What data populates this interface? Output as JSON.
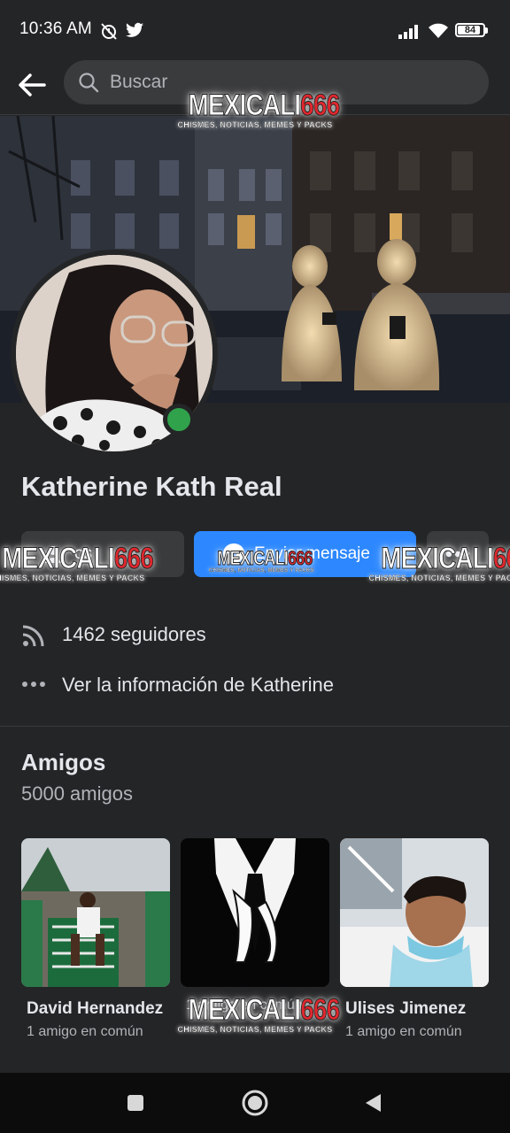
{
  "status_bar": {
    "time": "10:36 AM",
    "battery": "84",
    "icons": [
      "mute-alarm-icon",
      "twitter-icon",
      "signal-icon",
      "wifi-icon",
      "battery-icon"
    ]
  },
  "header": {
    "search_placeholder": "Buscar"
  },
  "profile": {
    "name": "Katherine Kath Real",
    "online": true
  },
  "actions": {
    "friends_label": "Amigos",
    "friends_visible": "os",
    "message_label": "Enviar mensaje",
    "message_visible": "Enviar mensaje"
  },
  "info": {
    "followers": "1462 seguidores",
    "see_info": "Ver la información de Katherine"
  },
  "friends": {
    "title": "Amigos",
    "count": "5000 amigos",
    "items": [
      {
        "name": "David Hernandez",
        "mutual": "1 amigo en común"
      },
      {
        "name": "",
        "mutual": "1 amigo en común"
      },
      {
        "name": "Ulises Jimenez",
        "mutual": "1 amigo en común"
      }
    ]
  },
  "watermark": {
    "text": "MEXICALI",
    "number": "666",
    "tagline": "CHISMES, NOTICIAS, MEMES Y PACKS"
  },
  "colors": {
    "background": "#242526",
    "accent": "#2d88ff",
    "online": "#31a24c"
  }
}
